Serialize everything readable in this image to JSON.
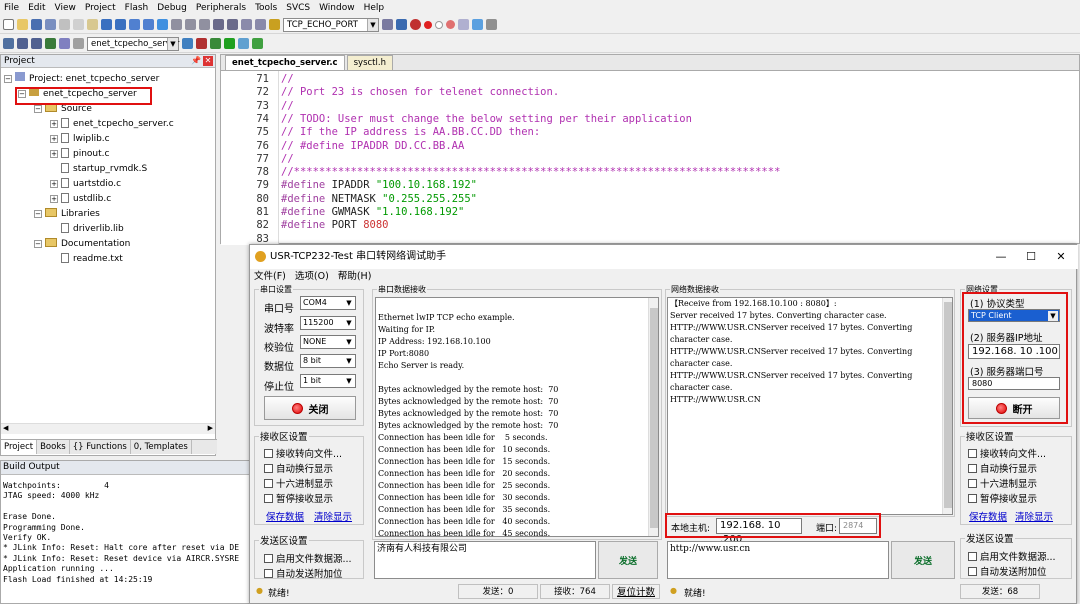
{
  "ide": {
    "menu": [
      "File",
      "Edit",
      "View",
      "Project",
      "Flash",
      "Debug",
      "Peripherals",
      "Tools",
      "SVCS",
      "Window",
      "Help"
    ],
    "target_combo": "TCP_ECHO_PORT",
    "project_combo": "enet_tcpecho_server",
    "project_panel_title": "Project",
    "tree": {
      "root": "Project: enet_tcpecho_server",
      "target": "enet_tcpecho_server",
      "source_group": "Source",
      "files": [
        "enet_tcpecho_server.c",
        "lwiplib.c",
        "pinout.c",
        "startup_rvmdk.S",
        "uartstdio.c",
        "ustdlib.c"
      ],
      "libraries_group": "Libraries",
      "lib_files": [
        "driverlib.lib"
      ],
      "docs_group": "Documentation",
      "doc_files": [
        "readme.txt"
      ]
    },
    "panel_tabs": [
      "Project",
      "Books",
      "{} Functions",
      "0, Templates"
    ],
    "build_output_title": "Build Output",
    "build_lines": [
      "Watchpoints:         4",
      "JTAG speed: 4000 kHz",
      "",
      "Erase Done.",
      "Programming Done.",
      "Verify OK.",
      "* JLink Info: Reset: Halt core after reset via DE",
      "* JLink Info: Reset: Reset device via AIRCR.SYSRE",
      "Application running ...",
      "Flash Load finished at 14:25:19"
    ],
    "editor_tabs": [
      "enet_tcpecho_server.c",
      "sysctl.h"
    ],
    "code_lines": [
      {
        "n": "71",
        "segs": [
          {
            "t": "//",
            "c": "c-com"
          }
        ]
      },
      {
        "n": "72",
        "segs": [
          {
            "t": "// Port 23 is chosen for telenet connection.",
            "c": "c-com"
          }
        ]
      },
      {
        "n": "73",
        "segs": [
          {
            "t": "//",
            "c": "c-com"
          }
        ]
      },
      {
        "n": "74",
        "segs": [
          {
            "t": "// TODO: User must change the below setting per their application",
            "c": "c-com"
          }
        ]
      },
      {
        "n": "75",
        "segs": [
          {
            "t": "// If the IP address is AA.BB.CC.DD then:",
            "c": "c-com"
          }
        ]
      },
      {
        "n": "76",
        "segs": [
          {
            "t": "// #define IPADDR DD.CC.BB.AA",
            "c": "c-com"
          }
        ]
      },
      {
        "n": "77",
        "segs": [
          {
            "t": "//",
            "c": "c-com"
          }
        ]
      },
      {
        "n": "78",
        "segs": [
          {
            "t": "//*****************************************************************************",
            "c": "c-com"
          }
        ]
      },
      {
        "n": "79",
        "segs": [
          {
            "t": "#define",
            "c": "c-pre"
          },
          {
            "t": " IPADDR ",
            "c": "c-idt"
          },
          {
            "t": "\"100.10.168.192\"",
            "c": "c-str"
          }
        ]
      },
      {
        "n": "80",
        "segs": [
          {
            "t": "#define",
            "c": "c-pre"
          },
          {
            "t": " NETMASK ",
            "c": "c-idt"
          },
          {
            "t": "\"0.255.255.255\"",
            "c": "c-str"
          }
        ]
      },
      {
        "n": "81",
        "segs": [
          {
            "t": "#define",
            "c": "c-pre"
          },
          {
            "t": " GWMASK ",
            "c": "c-idt"
          },
          {
            "t": "\"1.10.168.192\"",
            "c": "c-str"
          }
        ]
      },
      {
        "n": "82",
        "segs": [
          {
            "t": "#define",
            "c": "c-pre"
          },
          {
            "t": " PORT ",
            "c": "c-idt"
          },
          {
            "t": "8080",
            "c": "c-num"
          }
        ]
      },
      {
        "n": "83",
        "segs": []
      }
    ]
  },
  "app": {
    "title": "USR-TCP232-Test 串口转网络调试助手",
    "menu": [
      "文件(F)",
      "选项(O)",
      "帮助(H)"
    ],
    "serial_settings": {
      "legend": "串口设置",
      "port_label": "串口号",
      "port_value": "COM4",
      "baud_label": "波特率",
      "baud_value": "115200",
      "parity_label": "校验位",
      "parity_value": "NONE",
      "data_label": "数据位",
      "data_value": "8 bit",
      "stop_label": "停止位",
      "stop_value": "1 bit",
      "close_button": "关闭"
    },
    "serial_recv": {
      "legend": "串口数据接收",
      "lines": [
        "",
        "Ethernet lwIP TCP echo example.",
        "Waiting for IP.",
        "IP Address: 192.168.10.100",
        "IP Port:8080",
        "Echo Server is ready.",
        "",
        "Bytes acknowledged by the remote host:  70",
        "Bytes acknowledged by the remote host:  70",
        "Bytes acknowledged by the remote host:  70",
        "Bytes acknowledged by the remote host:  70",
        "Connection has been idle for    5 seconds.",
        "Connection has been idle for   10 seconds.",
        "Connection has been idle for   15 seconds.",
        "Connection has been idle for   20 seconds.",
        "Connection has been idle for   25 seconds.",
        "Connection has been idle for   30 seconds.",
        "Connection has been idle for   35 seconds.",
        "Connection has been idle for   40 seconds.",
        "Connection has been idle for   45 seconds."
      ]
    },
    "net_recv": {
      "legend": "网络数据接收",
      "lines": [
        "【Receive from 192.168.10.100 : 8080】:",
        "Server received 17 bytes. Converting character case.",
        "HTTP://WWW.USR.CNServer received 17 bytes. Converting",
        "character case.",
        "HTTP://WWW.USR.CNServer received 17 bytes. Converting",
        "character case.",
        "HTTP://WWW.USR.CNServer received 17 bytes. Converting",
        "character case.",
        "HTTP://WWW.USR.CN"
      ]
    },
    "net_settings": {
      "legend": "网络设置",
      "protocol_label": "(1) 协议类型",
      "protocol_value": "TCP Client",
      "ip_label": "(2) 服务器IP地址",
      "ip_value": "192.168. 10 .100",
      "port_label": "(3) 服务器端口号",
      "port_value": "8080",
      "disconnect_button": "断开"
    },
    "serial_rx_opts": {
      "legend": "接收区设置",
      "opts": [
        "接收转向文件...",
        "自动换行显示",
        "十六进制显示",
        "暂停接收显示"
      ],
      "save_link": "保存数据",
      "clear_link": "清除显示"
    },
    "net_rx_opts": {
      "legend": "接收区设置",
      "opts": [
        "接收转向文件...",
        "自动换行显示",
        "十六进制显示",
        "暂停接收显示"
      ],
      "save_link": "保存数据",
      "clear_link": "清除显示"
    },
    "serial_tx_opts": {
      "legend": "发送区设置",
      "opts": [
        "启用文件数据源...",
        "自动发送附加位"
      ]
    },
    "net_tx_opts": {
      "legend": "发送区设置",
      "opts": [
        "启用文件数据源...",
        "自动发送附加位"
      ]
    },
    "local_host": {
      "label": "本地主机:",
      "ip": "192.168. 10 .200",
      "port_label": "端口:",
      "port": "2874"
    },
    "serial_send_text": "济南有人科技有限公司",
    "net_send_text": "http://www.usr.cn",
    "send_button": "发送",
    "status_left": {
      "ready": "就绪!",
      "sent": "发送：0",
      "recv": "接收：764",
      "reset": "复位计数"
    },
    "status_right": {
      "ready": "就绪!",
      "sent": "发送：68"
    },
    "colors": {
      "highlight_box": "#e01010",
      "disconnect_dot": "#e00000",
      "link": "#0000cc"
    }
  }
}
